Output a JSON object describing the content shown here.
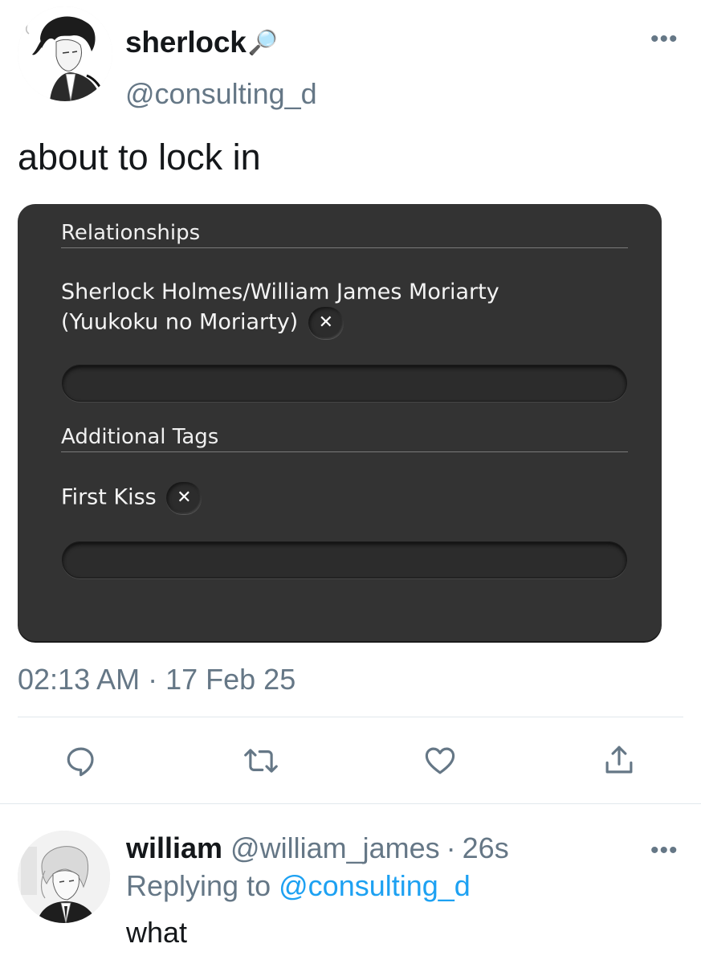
{
  "tweet": {
    "author": {
      "display_name": "sherlock",
      "name_emoji": "🔎",
      "handle": "@consulting_d",
      "avatar_icon": "sherlock-avatar-illustration"
    },
    "more_icon": "more-dots-icon",
    "more_label": "•••",
    "text": "about to lock in",
    "media": {
      "sections": [
        {
          "heading": "Relationships",
          "tags": [
            {
              "line1": "Sherlock Holmes/William James Moriarty",
              "line2": "(Yuukoku no Moriarty)"
            }
          ]
        },
        {
          "heading": "Additional Tags",
          "tags": [
            {
              "line1": "First Kiss"
            }
          ]
        }
      ],
      "remove_label": "✕"
    },
    "timestamp": "02:13 AM · 17 Feb 25",
    "actions": [
      {
        "name": "reply",
        "icon": "reply-icon"
      },
      {
        "name": "retweet",
        "icon": "retweet-icon"
      },
      {
        "name": "like",
        "icon": "heart-icon"
      },
      {
        "name": "share",
        "icon": "share-icon"
      }
    ]
  },
  "reply": {
    "author": {
      "display_name": "william",
      "handle": "@william_james",
      "separator": "·",
      "age": "26s",
      "avatar_icon": "william-avatar-illustration"
    },
    "replying_prefix": "Replying to",
    "replying_to": "@consulting_d",
    "text": "what",
    "more_label": "•••"
  },
  "colors": {
    "secondary_text": "#657786",
    "link": "#1da1f2",
    "card_bg": "#333333",
    "divider": "#e1e8ed"
  }
}
